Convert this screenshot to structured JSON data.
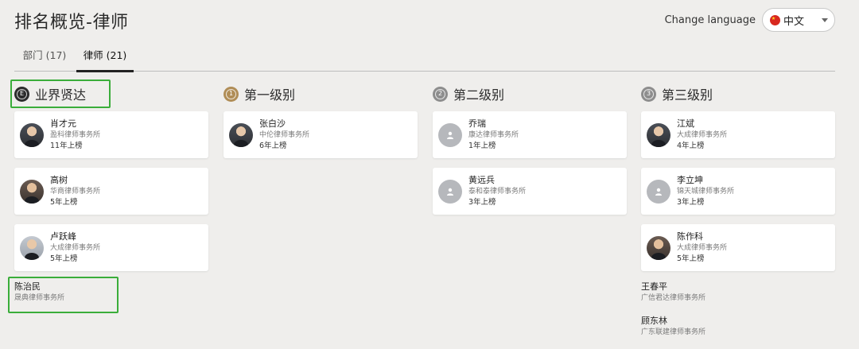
{
  "page": {
    "title": "排名概览-律师"
  },
  "language": {
    "label": "Change language",
    "selected": "中文",
    "flag_icon": "china-flag-icon"
  },
  "tabs": [
    {
      "label": "部门 (17)",
      "active": false
    },
    {
      "label": "律师 (21)",
      "active": true
    }
  ],
  "columns": [
    {
      "badge": "E",
      "title": "业界贤达",
      "cards": [
        {
          "name": "肖才元",
          "firm": "盈科律师事务所",
          "years": "11年上榜"
        },
        {
          "name": "高树",
          "firm": "华商律师事务所",
          "years": "5年上榜"
        },
        {
          "name": "卢跃峰",
          "firm": "大成律师事务所",
          "years": "5年上榜"
        }
      ],
      "plain": [
        {
          "name": "陈治民",
          "firm": "晟典律师事务所"
        }
      ]
    },
    {
      "badge": "1",
      "title": "第一级别",
      "cards": [
        {
          "name": "张白沙",
          "firm": "中伦律师事务所",
          "years": "6年上榜"
        }
      ],
      "plain": []
    },
    {
      "badge": "2",
      "title": "第二级别",
      "cards": [
        {
          "name": "乔瑞",
          "firm": "康达律师事务所",
          "years": "1年上榜"
        },
        {
          "name": "黄远兵",
          "firm": "泰和泰律师事务所",
          "years": "3年上榜"
        }
      ],
      "plain": []
    },
    {
      "badge": "3",
      "title": "第三级别",
      "cards": [
        {
          "name": "江斌",
          "firm": "大成律师事务所",
          "years": "4年上榜"
        },
        {
          "name": "李立坤",
          "firm": "锦天城律师事务所",
          "years": "3年上榜"
        },
        {
          "name": "陈作科",
          "firm": "大成律师事务所",
          "years": "5年上榜"
        }
      ],
      "plain": [
        {
          "name": "王春平",
          "firm": "广信君达律师事务所"
        },
        {
          "name": "顾东林",
          "firm": "广东联建律师事务所"
        }
      ]
    }
  ],
  "colors": {
    "highlight": "#3aad3a",
    "gold_badge": "#b08d56",
    "dark_badge": "#2c2c2c",
    "gray_badge": "#8d8d8d"
  }
}
